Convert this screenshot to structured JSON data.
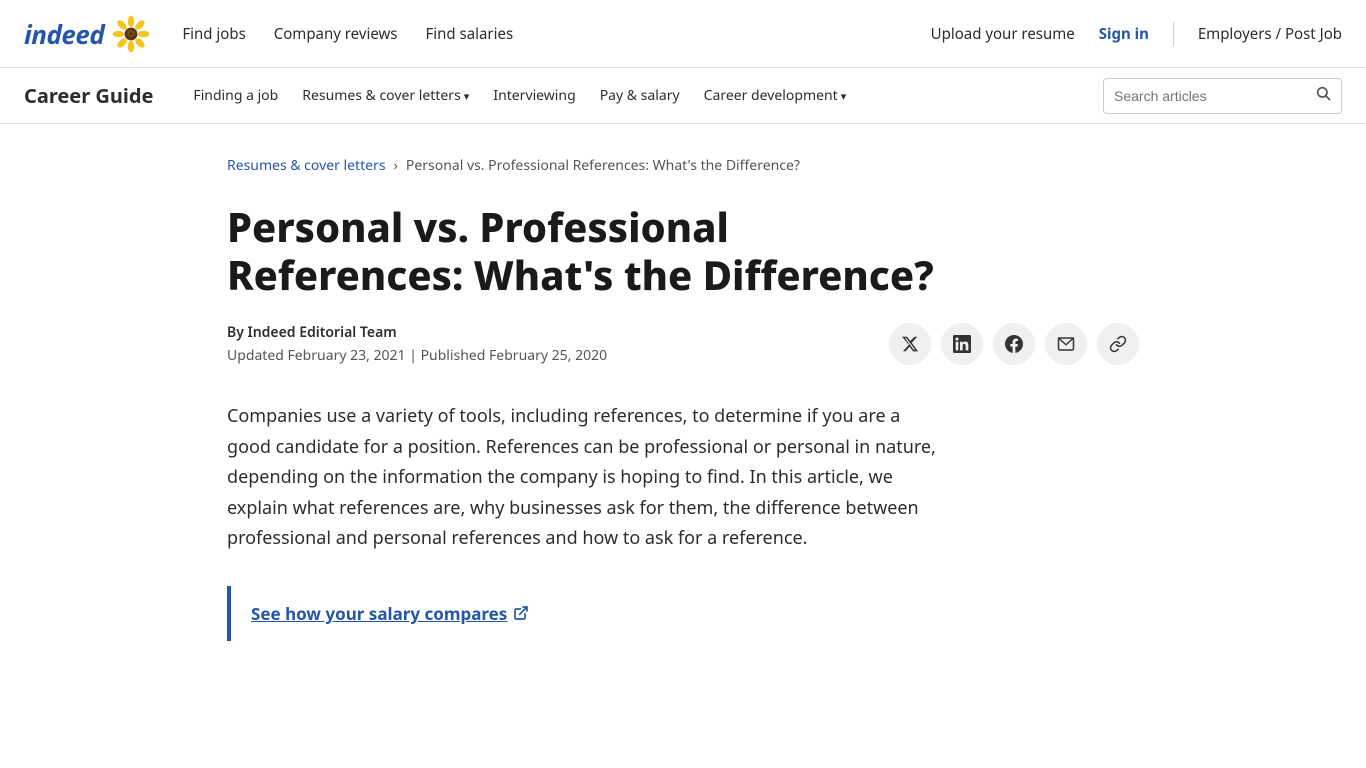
{
  "top_nav": {
    "logo_text": "indeed",
    "nav_links": [
      {
        "label": "Find jobs",
        "href": "#"
      },
      {
        "label": "Company reviews",
        "href": "#"
      },
      {
        "label": "Find salaries",
        "href": "#"
      }
    ],
    "upload_resume": "Upload your resume",
    "sign_in": "Sign in",
    "employers": "Employers / Post Job"
  },
  "sub_nav": {
    "title": "Career Guide",
    "links": [
      {
        "label": "Finding a job",
        "has_dropdown": false
      },
      {
        "label": "Resumes & cover letters",
        "has_dropdown": true
      },
      {
        "label": "Interviewing",
        "has_dropdown": false
      },
      {
        "label": "Pay & salary",
        "has_dropdown": false
      },
      {
        "label": "Career development",
        "has_dropdown": true
      }
    ],
    "search_placeholder": "Search articles"
  },
  "breadcrumb": {
    "parent_label": "Resumes & cover letters",
    "current": "Personal vs. Professional References: What's the Difference?"
  },
  "article": {
    "title": "Personal vs. Professional References: What's the Difference?",
    "author": "By Indeed Editorial Team",
    "updated": "Updated February 23, 2021",
    "published": "Published February 25, 2020",
    "body": "Companies use a variety of tools, including references, to determine if you are a good candidate for a position. References can be professional or personal in nature, depending on the information the company is hoping to find. In this article, we explain what references are, why businesses ask for them, the difference between professional and personal references and how to ask for a reference.",
    "salary_cta_label": "See how your salary compares"
  },
  "share": {
    "twitter": "𝕏",
    "linkedin": "in",
    "facebook": "f",
    "email": "✉",
    "link": "🔗"
  }
}
